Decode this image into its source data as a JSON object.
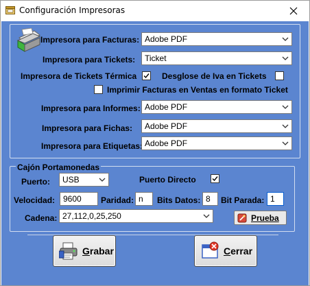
{
  "window": {
    "title": "Configuración Impresoras",
    "close_glyph": "✕"
  },
  "printers": {
    "facturas_label": "Impresora para Facturas:",
    "facturas_value": "Adobe PDF",
    "tickets_label": "Impresora para Tickets:",
    "tickets_value": "Ticket",
    "termica_label": "Impresora de Tickets Térmica",
    "termica_checked": true,
    "desglose_label": "Desglose de Iva en Tickets",
    "desglose_checked": false,
    "imprimir_label": "Imprimir Facturas en Ventas en formato Ticket",
    "imprimir_checked": false,
    "informes_label": "Impresora para Informes:",
    "informes_value": "Adobe PDF",
    "fichas_label": "Impresora para Fichas:",
    "fichas_value": "Adobe PDF",
    "etiquetas_label": "Impresora para Etiquetas:",
    "etiquetas_value": "Adobe PDF"
  },
  "cajon": {
    "title": "Cajón Portamonedas",
    "puerto_label": "Puerto:",
    "puerto_value": "USB",
    "puerto_directo_label": "Puerto Directo",
    "puerto_directo_checked": true,
    "velocidad_label": "Velocidad:",
    "velocidad_value": "9600",
    "paridad_label": "Paridad:",
    "paridad_value": "n",
    "bits_datos_label": "Bits Datos:",
    "bits_datos_value": "8",
    "bit_parada_label": "Bit Parada:",
    "bit_parada_value": "1",
    "cadena_label": "Cadena:",
    "cadena_value": "27,112,0,25,250",
    "prueba_label": "Prueba"
  },
  "buttons": {
    "grabar_accel": "G",
    "grabar_rest": "rabar",
    "cerrar_accel": "C",
    "cerrar_rest": "errar"
  },
  "icons": {
    "title": "app-window-icon",
    "printer": "printer-icon",
    "prueba": "test-icon",
    "grabar": "save-printer-icon",
    "cerrar": "close-window-icon"
  }
}
